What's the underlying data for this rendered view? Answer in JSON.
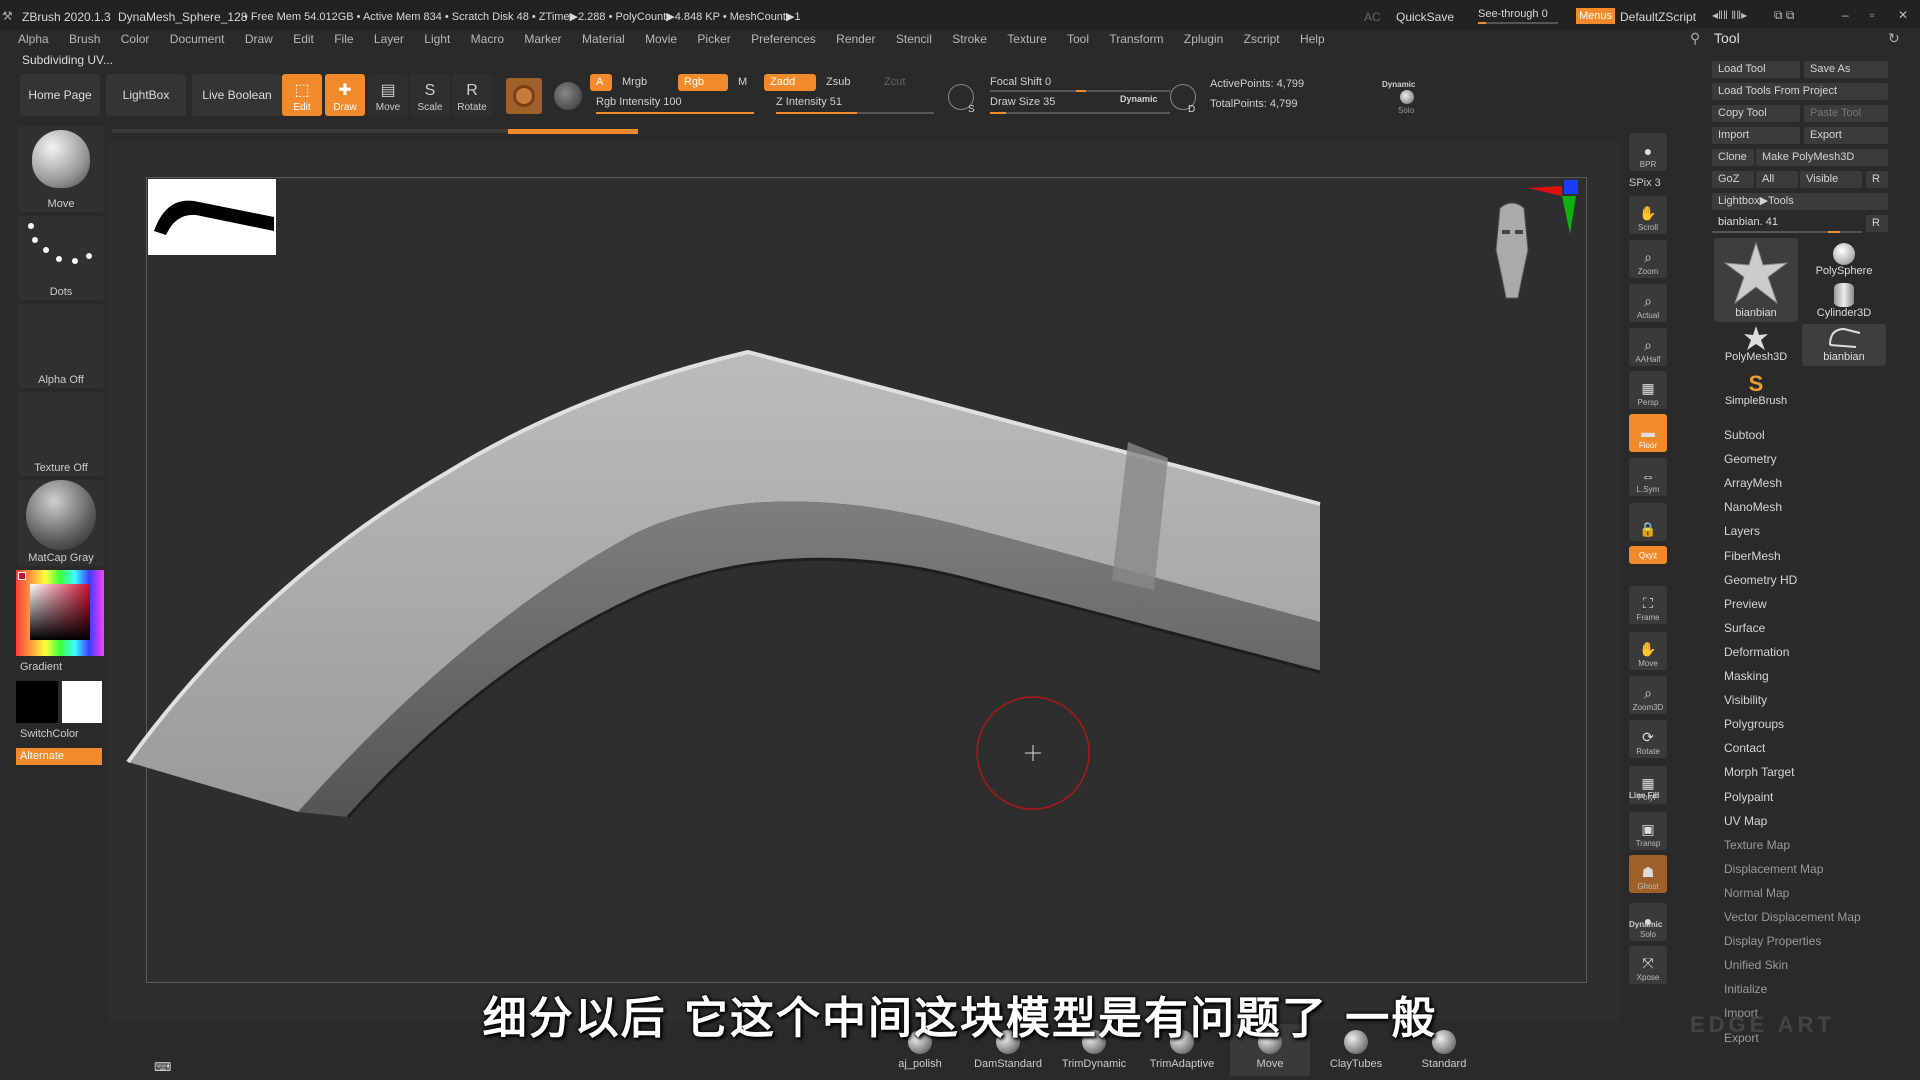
{
  "titlebar": {
    "app": "ZBrush 2020.1.3",
    "doc": "DynaMesh_Sphere_128",
    "stats": "• Free Mem 54.012GB • Active Mem 834 • Scratch Disk 48 •  ZTime▶2.288 • PolyCount▶4.848 KP  • MeshCount▶1",
    "ac": "AC",
    "quicksave": "QuickSave",
    "seethrough": "See-through  0",
    "menus": "Menus",
    "script": "DefaultZScript"
  },
  "menu": [
    "Alpha",
    "Brush",
    "Color",
    "Document",
    "Draw",
    "Edit",
    "File",
    "Layer",
    "Light",
    "Macro",
    "Marker",
    "Material",
    "Movie",
    "Picker",
    "Preferences",
    "Render",
    "Stencil",
    "Stroke",
    "Texture",
    "Tool",
    "Transform",
    "Zplugin",
    "Zscript",
    "Help"
  ],
  "status": "Subdividing UV...",
  "topshelf": {
    "home": "Home Page",
    "lightbox": "LightBox",
    "liveboolean": "Live Boolean",
    "edit": "Edit",
    "draw": "Draw",
    "move": "Move",
    "scale": "Scale",
    "rotate": "Rotate",
    "a": "A",
    "mrgb": "Mrgb",
    "rgb": "Rgb",
    "m": "M",
    "zadd": "Zadd",
    "zsub": "Zsub",
    "zcut": "Zcut",
    "rgb_intensity": "Rgb Intensity 100",
    "z_intensity": "Z Intensity 51",
    "focal_shift": "Focal Shift 0",
    "draw_size": "Draw Size 35",
    "dynamic": "Dynamic",
    "active_points": "ActivePoints: 4,799",
    "total_points": "TotalPoints: 4,799",
    "solo_dynamic": "Dynamic",
    "solo": "Solo",
    "rgb_intensity_value": 100,
    "z_intensity_value": 51
  },
  "leftshelf": {
    "brush": "Move",
    "stroke": "Dots",
    "alpha": "Alpha Off",
    "texture": "Texture Off",
    "material": "MatCap Gray",
    "gradient": "Gradient",
    "switchcolor": "SwitchColor",
    "alternate": "Alternate"
  },
  "rightshelf": [
    {
      "name": "bpr",
      "label": "BPR",
      "icon": "●"
    },
    {
      "name": "scroll",
      "label": "Scroll",
      "icon": "✋"
    },
    {
      "name": "zoom",
      "label": "Zoom",
      "icon": "⌕"
    },
    {
      "name": "actual",
      "label": "Actual",
      "icon": "⌕"
    },
    {
      "name": "aahalf",
      "label": "AAHalf",
      "icon": "⌕"
    },
    {
      "name": "persp",
      "label": "Persp",
      "icon": "▦"
    },
    {
      "name": "floor",
      "label": "Floor",
      "icon": "▬"
    },
    {
      "name": "lsym",
      "label": "L.Sym",
      "icon": "⇔"
    },
    {
      "name": "lock",
      "label": "",
      "icon": "🔒"
    },
    {
      "name": "xyz",
      "label": "Qxyz",
      "icon": ""
    },
    {
      "name": "frame",
      "label": "Frame",
      "icon": "⛶"
    },
    {
      "name": "move",
      "label": "Move",
      "icon": "✋"
    },
    {
      "name": "zoom3d",
      "label": "Zoom3D",
      "icon": "⌕"
    },
    {
      "name": "rotate",
      "label": "Rotate",
      "icon": "⟳"
    },
    {
      "name": "polyf",
      "label": "PolyF",
      "icon": "▦"
    },
    {
      "name": "transp",
      "label": "Transp",
      "icon": "▣"
    },
    {
      "name": "ghost",
      "label": "Ghost",
      "icon": "☗"
    },
    {
      "name": "solo",
      "label": "Solo",
      "icon": "●"
    },
    {
      "name": "xpose",
      "label": "Xpose",
      "icon": "⤧"
    }
  ],
  "rightshelf_extra": {
    "spix": "SPix 3",
    "linefill": "Line Fill",
    "dynamic": "Dynamic"
  },
  "toolpanel": {
    "title": "Tool",
    "buttons": {
      "load_tool": "Load Tool",
      "save_as": "Save As",
      "load_from_project": "Load Tools From Project",
      "copy_tool": "Copy Tool",
      "paste_tool": "Paste Tool",
      "import": "Import",
      "export": "Export",
      "clone": "Clone",
      "make_polymesh": "Make PolyMesh3D",
      "goz": "GoZ",
      "all": "All",
      "visible": "Visible",
      "r": "R",
      "lightbox_tools": "Lightbox▶Tools",
      "current": "bianbian. 41",
      "r2": "R"
    },
    "thumbs": [
      "bianbian",
      "PolySphere",
      "Cylinder3D",
      "PolyMesh3D",
      "bianbian",
      "SimpleBrush"
    ],
    "subpalettes": [
      "Subtool",
      "Geometry",
      "ArrayMesh",
      "NanoMesh",
      "Layers",
      "FiberMesh",
      "Geometry HD",
      "Preview",
      "Surface",
      "Deformation",
      "Masking",
      "Visibility",
      "Polygroups",
      "Contact",
      "Morph Target",
      "Polypaint",
      "UV Map",
      "Texture Map",
      "Displacement Map",
      "Normal Map",
      "Vector Displacement Map",
      "Display Properties",
      "Unified Skin",
      "Initialize",
      "Import",
      "Export"
    ]
  },
  "brushes": [
    "aj_polish",
    "DamStandard",
    "TrimDynamic",
    "TrimAdaptive",
    "Move",
    "ClayTubes",
    "Standard"
  ],
  "subtitle": "细分以后 它这个中间这块模型是有问题了 一般",
  "colors": {
    "accent": "#f08a2a",
    "panel": "#2a2a2a",
    "canvas": "#2e2e2e"
  }
}
